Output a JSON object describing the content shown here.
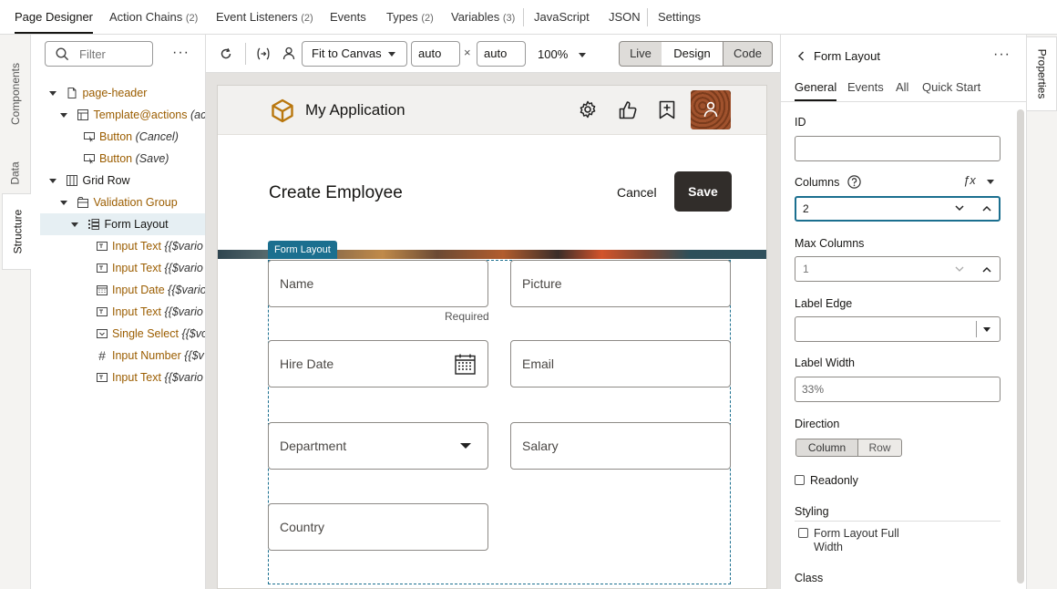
{
  "top_tabs": [
    {
      "label": "Page Designer",
      "count": ""
    },
    {
      "label": "Action Chains",
      "count": "(2)"
    },
    {
      "label": "Event Listeners",
      "count": "(2)"
    },
    {
      "label": "Events",
      "count": ""
    },
    {
      "label": "Types",
      "count": "(2)"
    },
    {
      "label": "Variables",
      "count": "(3)"
    },
    {
      "label": "JavaScript",
      "count": ""
    },
    {
      "label": "JSON",
      "count": ""
    },
    {
      "label": "Settings",
      "count": ""
    }
  ],
  "left_tabs": [
    "Components",
    "Data",
    "Structure"
  ],
  "right_tabs": [
    "Properties"
  ],
  "structure": {
    "filter_placeholder": "Filter",
    "nodes": [
      {
        "label": "page-header",
        "extra": ""
      },
      {
        "label": "Template",
        "extra": "@actions",
        "tail": "(ac"
      },
      {
        "label": "Button",
        "tail": "(Cancel)"
      },
      {
        "label": "Button",
        "tail": "(Save)"
      },
      {
        "label": "Grid Row",
        "tail": ""
      },
      {
        "label": "Validation Group",
        "tail": ""
      },
      {
        "label": "Form Layout",
        "tail": ""
      },
      {
        "label": "Input Text",
        "tail": "{{$vario"
      },
      {
        "label": "Input Text",
        "tail": "{{$vario"
      },
      {
        "label": "Input Date",
        "tail": "{{$vario"
      },
      {
        "label": "Input Text",
        "tail": "{{$vario"
      },
      {
        "label": "Single Select",
        "tail": "{{$vo"
      },
      {
        "label": "Input Number",
        "tail": "{{$v"
      },
      {
        "label": "Input Text",
        "tail": "{{$vario"
      }
    ]
  },
  "toolbar": {
    "fit": "Fit to Canvas",
    "width": "auto",
    "times": "×",
    "height": "auto",
    "zoom": "100%",
    "modes": [
      "Live",
      "Design",
      "Code"
    ]
  },
  "app": {
    "title": "My Application",
    "page_title": "Create Employee",
    "cancel": "Cancel",
    "save": "Save",
    "form_tag": "Form Layout",
    "fields": [
      {
        "label": "Name",
        "hint": "Required"
      },
      {
        "label": "Picture"
      },
      {
        "label": "Hire Date"
      },
      {
        "label": "Email"
      },
      {
        "label": "Department"
      },
      {
        "label": "Salary"
      },
      {
        "label": "Country"
      }
    ]
  },
  "properties": {
    "title": "Form Layout",
    "tabs": [
      "General",
      "Events",
      "All",
      "Quick Start"
    ],
    "id_label": "ID",
    "id_value": "",
    "columns_label": "Columns",
    "fx": "ƒx",
    "columns_value": "2",
    "max_columns_label": "Max Columns",
    "max_columns_value": "1",
    "label_edge_label": "Label Edge",
    "label_edge_value": "",
    "label_width_label": "Label Width",
    "label_width_value": "33%",
    "direction_label": "Direction",
    "direction_options": [
      "Column",
      "Row"
    ],
    "readonly_label": "Readonly",
    "styling_label": "Styling",
    "full_width_label_1": "Form Layout Full",
    "full_width_label_2": "Width",
    "class_label": "Class"
  },
  "colors": {
    "accent": "#1b6f8f",
    "dark_button": "#312d2a",
    "orange": "#9b5d00"
  }
}
